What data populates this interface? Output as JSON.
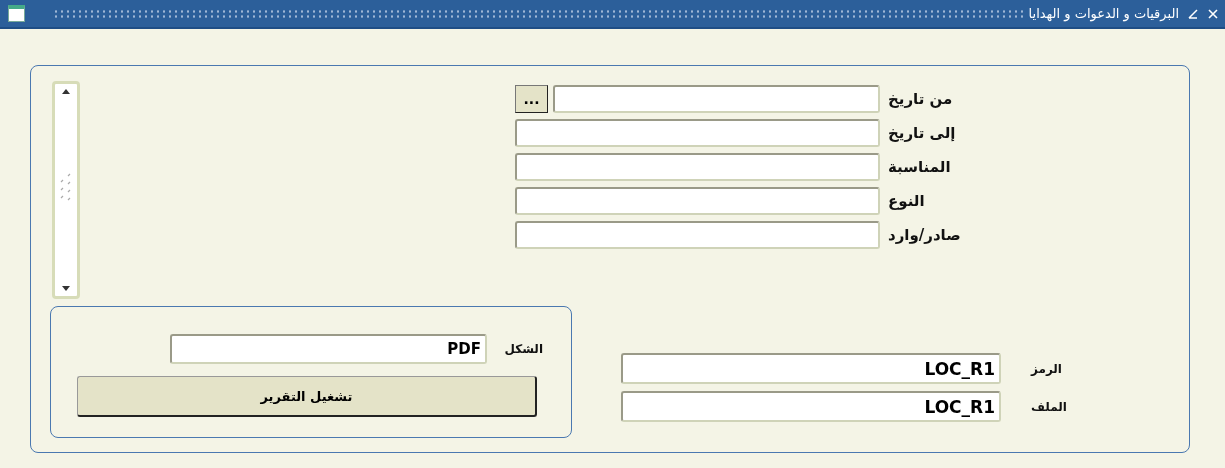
{
  "window": {
    "title": "البرقيات و الدعوات و الهدايا"
  },
  "criteria": [
    {
      "label": "من تاريخ",
      "kind": "date",
      "picker": "..."
    },
    {
      "label": "إلى تاريخ",
      "kind": "text"
    },
    {
      "label": "المناسبة",
      "kind": "text"
    },
    {
      "label": "النوع",
      "kind": "text"
    },
    {
      "label": "صادر/وارد",
      "kind": "text"
    }
  ],
  "output": {
    "format": {
      "label": "الشكل",
      "value": "PDF"
    },
    "run_button": "تشغيل التقرير"
  },
  "report": [
    {
      "label": "الرمز",
      "value": "LOC_R1"
    },
    {
      "label": "الملف",
      "value": "LOC_R1"
    }
  ]
}
